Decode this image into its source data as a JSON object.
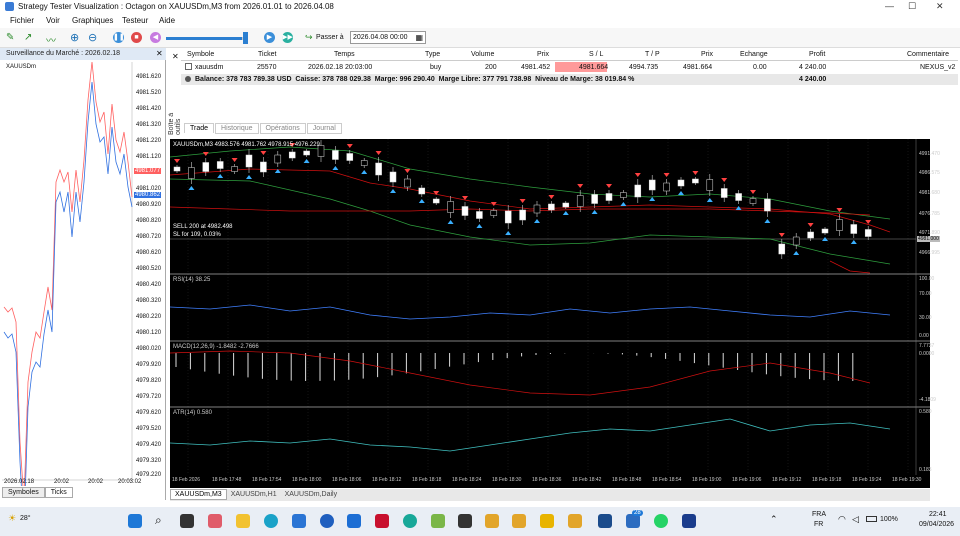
{
  "window": {
    "title": "Strategy Tester Visualization : Octagon on XAUUSDm,M3 from 2026.01.01 to 2026.04.08",
    "minimize_label": "—",
    "restore_label": "☐",
    "close_label": "✕"
  },
  "menu": [
    "Fichier",
    "Voir",
    "Graphiques",
    "Testeur",
    "Aide"
  ],
  "toolbar": {
    "skip_label": "Passer à",
    "skip_date_value": "2026.04.08 00:00"
  },
  "market_watch": {
    "header": "Surveillance du Marché : 2026.02.18",
    "symbol": "XAUUSDm",
    "price_labels": [
      "4981.620",
      "4981.520",
      "4981.420",
      "4981.320",
      "4981.220",
      "4981.120",
      "4981.020",
      "4980.920",
      "4980.820",
      "4980.720",
      "4980.620",
      "4980.520",
      "4980.420",
      "4980.320",
      "4980.220",
      "4980.120",
      "4980.020",
      "4979.920",
      "4979.820",
      "4979.720",
      "4979.620",
      "4979.520",
      "4979.420",
      "4979.320",
      "4979.220"
    ],
    "time_labels": [
      "2026.02.18",
      "20:02",
      "20:02",
      "20:03:02"
    ],
    "ask_badge": "4981.077",
    "bid_badge": "4980.862",
    "tabs": [
      "Symboles",
      "Ticks"
    ]
  },
  "trade_table": {
    "headers": [
      "Symbole",
      "Ticket",
      "Temps",
      "Type",
      "Volume",
      "Prix",
      "S / L",
      "T / P",
      "Prix",
      "Echange",
      "Profit",
      "Commentaire"
    ],
    "row": [
      "xauusdm",
      "25570",
      "2026.02.18 20:03:00",
      "buy",
      "200",
      "4981.452",
      "4981.664",
      "4994.735",
      "4981.664",
      "0.00",
      "4 240.00",
      "NEXUS_v2"
    ],
    "balance_text": "Balance: 378 783 789.38 USD  Caisse: 378 788 029.38  Marge: 996 290.40  Marge Libre: 377 791 738.98  Niveau de Marge: 38 019.84 %",
    "balance_profit": "4 240.00",
    "side_label": "Boîte à outils",
    "tabs": [
      "Trade",
      "Historique",
      "Opérations",
      "Journal"
    ]
  },
  "chart": {
    "header": "XAUUSDm,M3  4983.576  4981.762  4978.915  4976.229",
    "sell_label": "SELL 200 at 4982.498",
    "sl_label": "SL for 109, 0.03%",
    "price_scale": [
      "4991.470",
      "4986.575",
      "4981.680",
      "4976.785",
      "4971.890",
      "4966.995"
    ],
    "price_badge": "4981.000",
    "rsi_label": "RSI(14) 38.25",
    "rsi_scale": [
      "100.00",
      "70.00",
      "30.00",
      "0.00"
    ],
    "macd_label": "MACD(12,26,9) -1.8482 -2.7666",
    "macd_scale": [
      "7.7737",
      "0.0000",
      "-4.1809"
    ],
    "atr_label": "ATR(14) 0.580",
    "atr_scale": [
      "0.580",
      "0.183"
    ],
    "time_labels": [
      "18 Feb 2026",
      "18 Feb 17:48",
      "18 Feb 17:54",
      "18 Feb 18:00",
      "18 Feb 18:06",
      "18 Feb 18:12",
      "18 Feb 18:18",
      "18 Feb 18:24",
      "18 Feb 18:30",
      "18 Feb 18:36",
      "18 Feb 18:42",
      "18 Feb 18:48",
      "18 Feb 18:54",
      "18 Feb 19:00",
      "18 Feb 19:06",
      "18 Feb 19:12",
      "18 Feb 19:18",
      "18 Feb 19:24",
      "18 Feb 19:30"
    ],
    "tabs": [
      "XAUUSDm,M3",
      "XAUUSDm,H1",
      "XAUUSDm,Daily"
    ]
  },
  "taskbar": {
    "weather": "28°",
    "lang": "FRA",
    "lang2": "FR",
    "battery": "100%",
    "time": "22:41",
    "date": "09/04/2026",
    "badge_count": "28"
  },
  "colors": {
    "sl_cell": "#ff9a9a",
    "bull": "#ffffff",
    "bear": "#ff4040",
    "ma_green": "#2e9e3e",
    "ma_red": "#d01010",
    "rsi_line": "#4080ff",
    "atr_line": "#40c0c0"
  }
}
